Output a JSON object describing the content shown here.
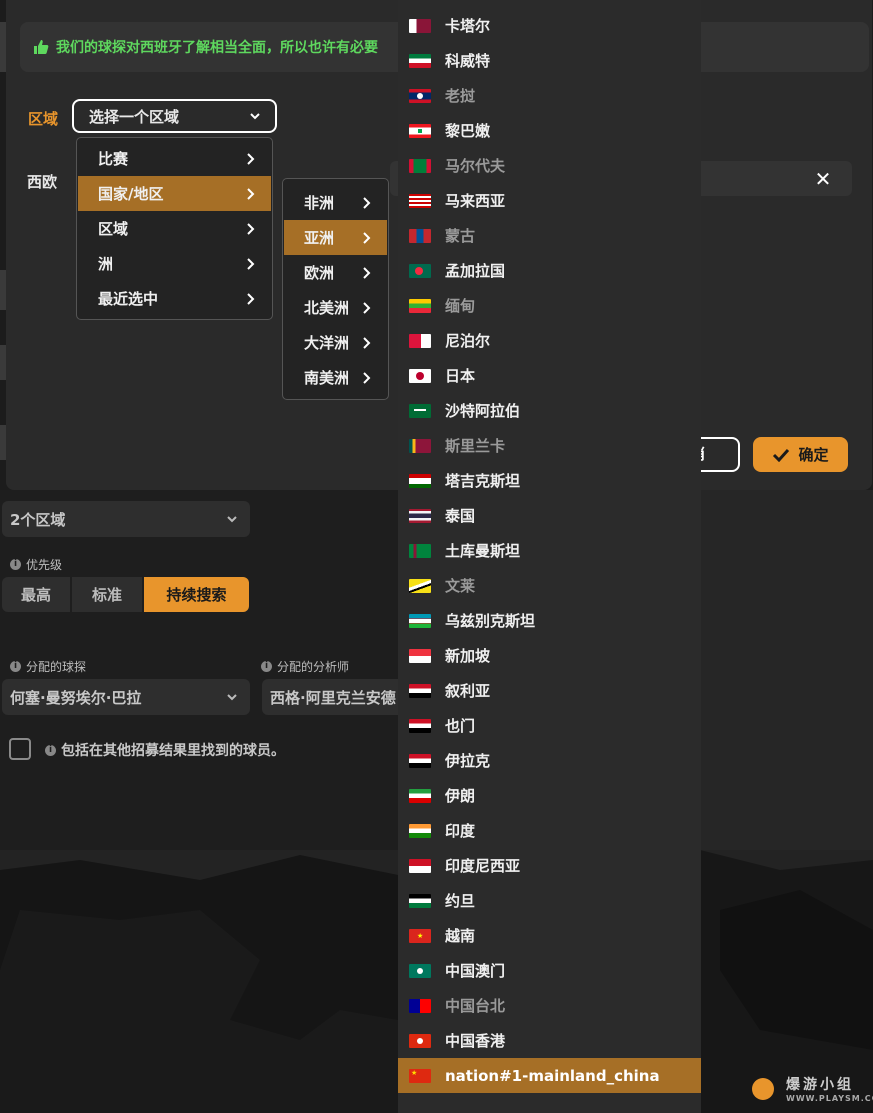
{
  "dialog": {
    "info_text": "我们的球探对西班牙了解相当全面，所以也许有必要",
    "region_label": "区域",
    "region_select_value": "选择一个区域",
    "selected_region": "西欧",
    "cancel_label": "取消",
    "confirm_label": "确定"
  },
  "menu_level1": {
    "items": [
      {
        "label": "比赛",
        "active": false
      },
      {
        "label": "国家/地区",
        "active": true
      },
      {
        "label": "区域",
        "active": false
      },
      {
        "label": "洲",
        "active": false
      },
      {
        "label": "最近选中",
        "active": false
      }
    ]
  },
  "menu_level2": {
    "items": [
      {
        "label": "非洲",
        "active": false
      },
      {
        "label": "亚洲",
        "active": true
      },
      {
        "label": "欧洲",
        "active": false
      },
      {
        "label": "北美洲",
        "active": false
      },
      {
        "label": "大洋洲",
        "active": false
      },
      {
        "label": "南美洲",
        "active": false
      }
    ]
  },
  "countries": [
    {
      "name": "卡塔尔",
      "flag": "qatar",
      "dim": false
    },
    {
      "name": "科威特",
      "flag": "kuwait",
      "dim": false
    },
    {
      "name": "老挝",
      "flag": "laos",
      "dim": true
    },
    {
      "name": "黎巴嫩",
      "flag": "lebanon",
      "dim": false
    },
    {
      "name": "马尔代夫",
      "flag": "maldives",
      "dim": true
    },
    {
      "name": "马来西亚",
      "flag": "malaysia",
      "dim": false
    },
    {
      "name": "蒙古",
      "flag": "mongolia",
      "dim": true
    },
    {
      "name": "孟加拉国",
      "flag": "bangladesh",
      "dim": false
    },
    {
      "name": "缅甸",
      "flag": "myanmar",
      "dim": true
    },
    {
      "name": "尼泊尔",
      "flag": "nepal",
      "dim": false
    },
    {
      "name": "日本",
      "flag": "japan",
      "dim": false
    },
    {
      "name": "沙特阿拉伯",
      "flag": "saudi",
      "dim": false
    },
    {
      "name": "斯里兰卡",
      "flag": "srilanka",
      "dim": true
    },
    {
      "name": "塔吉克斯坦",
      "flag": "tajikistan",
      "dim": false
    },
    {
      "name": "泰国",
      "flag": "thailand",
      "dim": false
    },
    {
      "name": "土库曼斯坦",
      "flag": "turkmenistan",
      "dim": false
    },
    {
      "name": "文莱",
      "flag": "brunei",
      "dim": true
    },
    {
      "name": "乌兹别克斯坦",
      "flag": "uzbekistan",
      "dim": false
    },
    {
      "name": "新加坡",
      "flag": "singapore",
      "dim": false
    },
    {
      "name": "叙利亚",
      "flag": "syria",
      "dim": false
    },
    {
      "name": "也门",
      "flag": "yemen",
      "dim": false
    },
    {
      "name": "伊拉克",
      "flag": "iraq",
      "dim": false
    },
    {
      "name": "伊朗",
      "flag": "iran",
      "dim": false
    },
    {
      "name": "印度",
      "flag": "india",
      "dim": false
    },
    {
      "name": "印度尼西亚",
      "flag": "indonesia",
      "dim": false
    },
    {
      "name": "约旦",
      "flag": "jordan",
      "dim": false
    },
    {
      "name": "越南",
      "flag": "vietnam",
      "dim": false
    },
    {
      "name": "中国澳门",
      "flag": "macau",
      "dim": false
    },
    {
      "name": "中国台北",
      "flag": "taipei",
      "dim": true
    },
    {
      "name": "中国香港",
      "flag": "hongkong",
      "dim": false
    },
    {
      "name": "nation#1-mainland_china",
      "flag": "china",
      "dim": false,
      "active": true
    }
  ],
  "lower": {
    "regions_value": "2个区域",
    "priority_label": "优先级",
    "priority_options": [
      {
        "label": "最高",
        "active": false
      },
      {
        "label": "标准",
        "active": false
      },
      {
        "label": "持续搜索",
        "active": true
      }
    ],
    "scout_label": "分配的球探",
    "scout_value": "何塞·曼努埃尔·巴拉",
    "analyst_label": "分配的分析师",
    "analyst_value": "西格·阿里克兰安德",
    "include_label": "包括在其他招募结果里找到的球员。"
  },
  "watermark": {
    "text": "爆游小组",
    "sub": "WWW.PLAYSM.CC"
  },
  "colors": {
    "accent": "#e8952c",
    "active_row": "#a66f26",
    "info_green": "#5ed85e"
  }
}
